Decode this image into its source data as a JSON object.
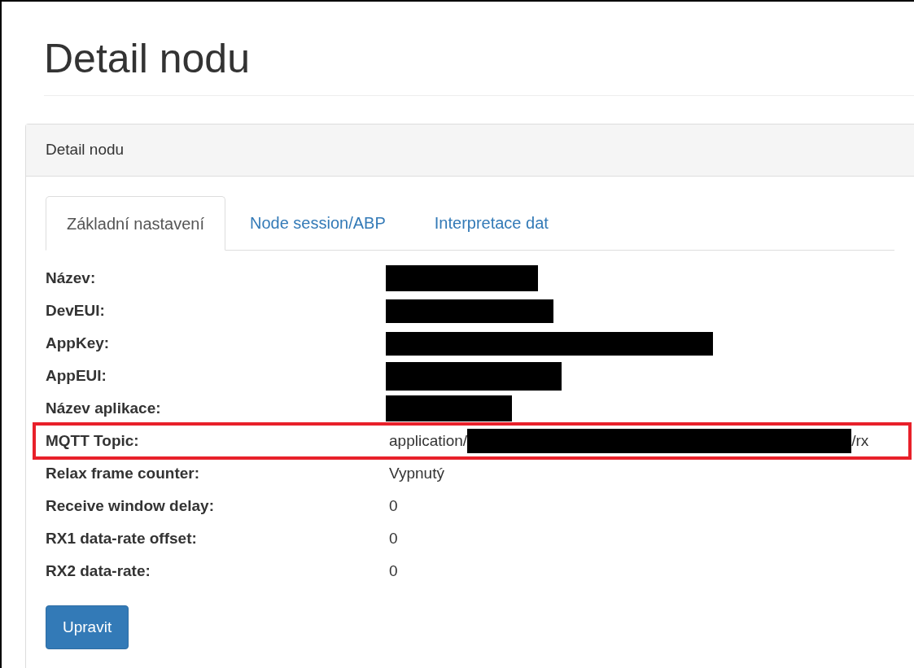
{
  "page_title": "Detail nodu",
  "panel": {
    "heading": "Detail nodu"
  },
  "tabs": [
    {
      "label": "Základní nastavení",
      "selected": true
    },
    {
      "label": "Node session/ABP",
      "selected": false
    },
    {
      "label": "Interpretace dat",
      "selected": false
    }
  ],
  "fields": [
    {
      "label": "Název:",
      "redacted": true,
      "highlighted": false
    },
    {
      "label": "DevEUI:",
      "redacted": true,
      "highlighted": false
    },
    {
      "label": "AppKey:",
      "redacted": true,
      "highlighted": false
    },
    {
      "label": "AppEUI:",
      "redacted": true,
      "highlighted": false
    },
    {
      "label": "Název aplikace:",
      "redacted": true,
      "highlighted": false
    },
    {
      "label": "MQTT Topic:",
      "value_prefix": "application/",
      "value_suffix": "/rx",
      "redacted": true,
      "highlighted": true
    },
    {
      "label": "Relax frame counter:",
      "value": "Vypnutý",
      "redacted": false,
      "highlighted": false
    },
    {
      "label": "Receive window delay:",
      "value": "0",
      "redacted": false,
      "highlighted": false
    },
    {
      "label": "RX1 data-rate offset:",
      "value": "0",
      "redacted": false,
      "highlighted": false
    },
    {
      "label": "RX2 data-rate:",
      "value": "0",
      "redacted": false,
      "highlighted": false
    }
  ],
  "edit_button": "Upravit"
}
